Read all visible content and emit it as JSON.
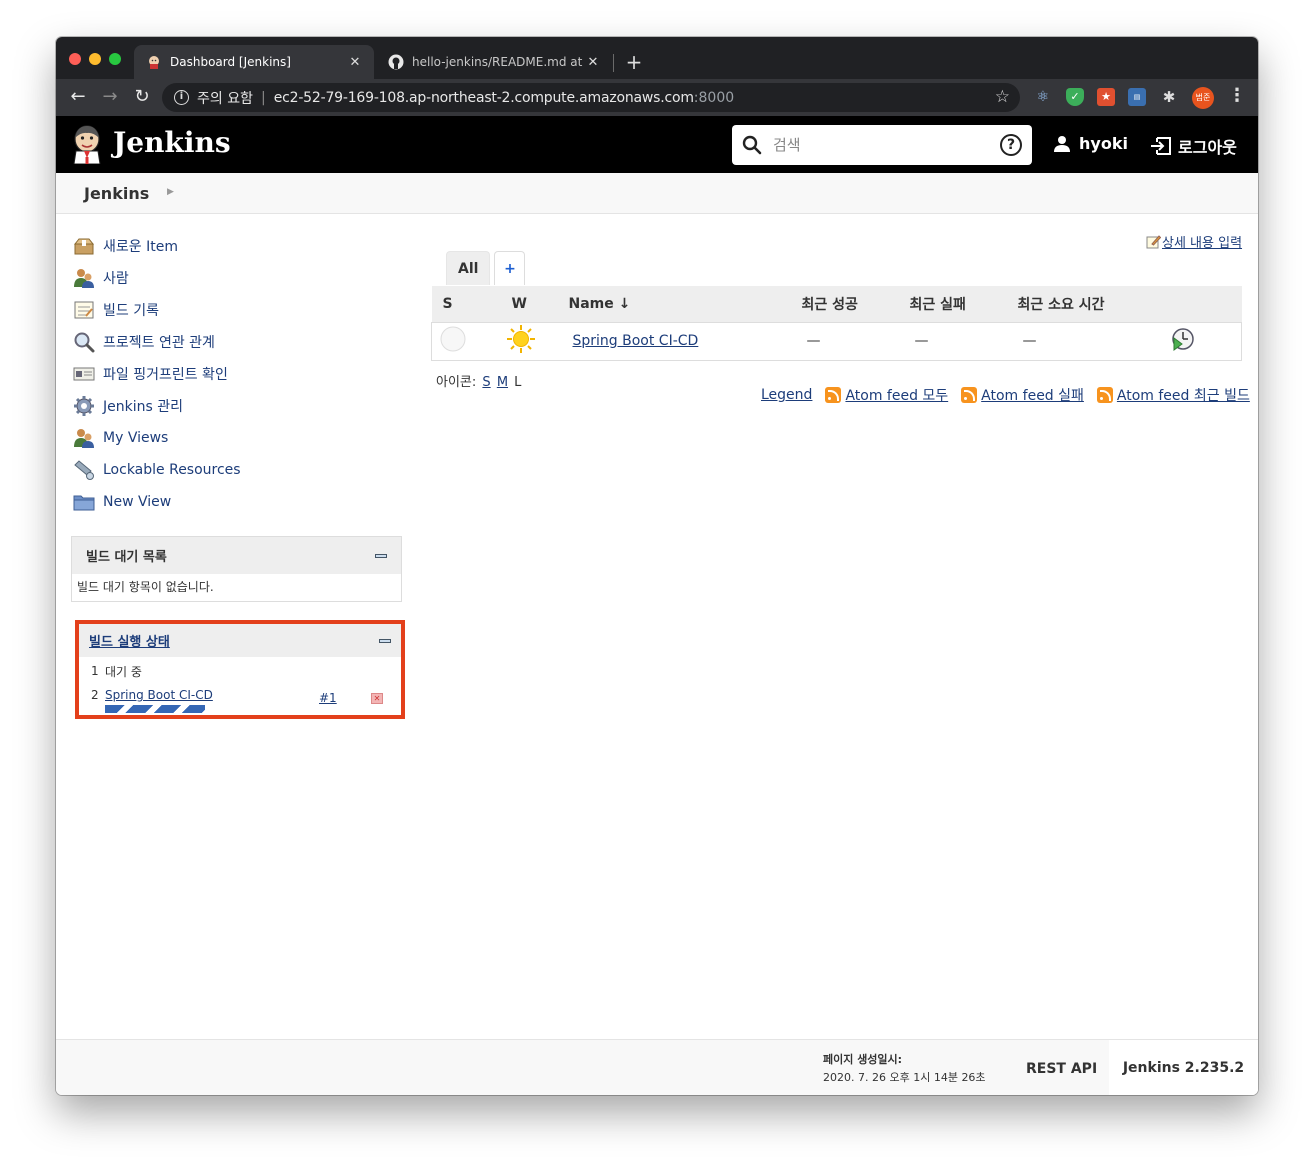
{
  "browser": {
    "tabs": [
      {
        "title": "Dashboard [Jenkins]",
        "active": true
      },
      {
        "title": "hello-jenkins/README.md at m",
        "active": false
      }
    ],
    "address": {
      "security_label": "주의 요함",
      "host": "ec2-52-79-169-108.ap-northeast-2.compute.amazonaws.com",
      "port": ":8000"
    },
    "profile_label": "범준"
  },
  "header": {
    "logo_text": "Jenkins",
    "search_placeholder": "검색",
    "help": "?",
    "user": "hyoki",
    "logout": "로그아웃"
  },
  "breadcrumb": {
    "root": "Jenkins"
  },
  "sidebar": {
    "tasks": [
      {
        "label": "새로운 Item",
        "icon": "new-item-icon"
      },
      {
        "label": "사람",
        "icon": "people-icon"
      },
      {
        "label": "빌드 기록",
        "icon": "build-history-icon"
      },
      {
        "label": "프로젝트 연관 관계",
        "icon": "project-relationship-icon"
      },
      {
        "label": "파일 핑거프린트 확인",
        "icon": "fingerprint-icon"
      },
      {
        "label": "Jenkins 관리",
        "icon": "manage-jenkins-icon"
      },
      {
        "label": "My Views",
        "icon": "my-views-icon"
      },
      {
        "label": "Lockable Resources",
        "icon": "lockable-resources-icon"
      },
      {
        "label": "New View",
        "icon": "new-view-icon"
      }
    ],
    "queue": {
      "title": "빌드 대기 목록",
      "empty": "빌드 대기 항목이 없습니다."
    },
    "executors": {
      "title": "빌드 실행 상태",
      "rows": [
        {
          "num": "1",
          "text": "대기 중"
        },
        {
          "num": "2",
          "job": "Spring Boot CI-CD",
          "build": "#1"
        }
      ]
    }
  },
  "main": {
    "add_description": "상세 내용 입력",
    "view_tabs": {
      "all": "All",
      "add": "+"
    },
    "columns": {
      "s": "S",
      "w": "W",
      "name": "Name ↓",
      "last_success": "최근 성공",
      "last_failure": "최근 실패",
      "last_duration": "최근 소요 시간"
    },
    "jobs": [
      {
        "name": "Spring Boot CI-CD",
        "last_success": "—",
        "last_failure": "—",
        "last_duration": "—"
      }
    ],
    "icon_sizes": {
      "label": "아이콘:",
      "s": "S",
      "m": "M",
      "l": "L"
    },
    "links": {
      "legend": "Legend",
      "feed_all": "Atom feed 모두",
      "feed_fail": "Atom feed 실패",
      "feed_latest": "Atom feed 최근 빌드"
    }
  },
  "footer": {
    "generated_label": "페이지 생성일시:",
    "generated_value": "2020. 7. 26 오후 1시 14분 26초",
    "rest_api": "REST API",
    "version": "Jenkins 2.235.2"
  }
}
